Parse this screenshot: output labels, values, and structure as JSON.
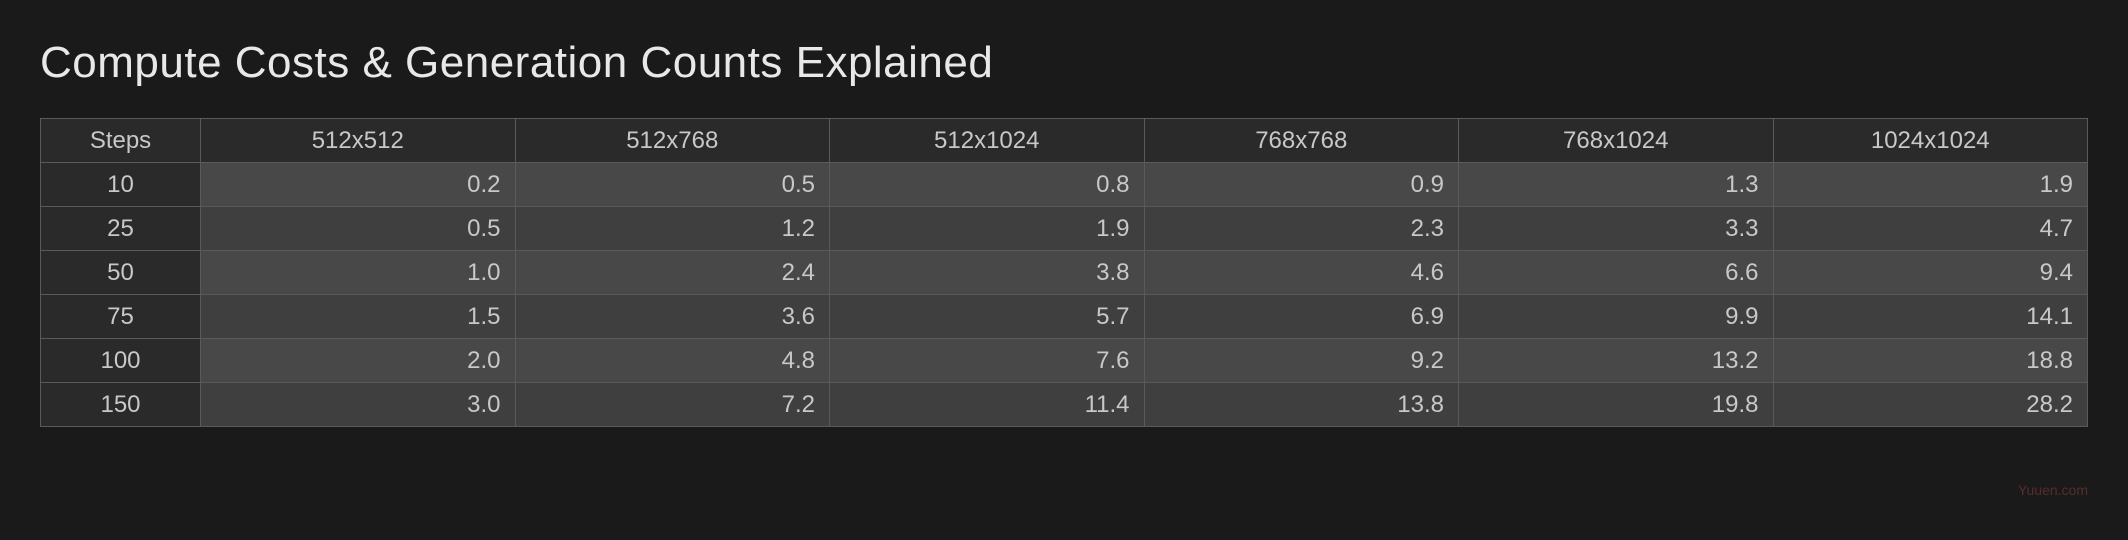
{
  "title": "Compute Costs & Generation Counts Explained",
  "chart_data": {
    "type": "table",
    "columns": [
      "Steps",
      "512x512",
      "512x768",
      "512x1024",
      "768x768",
      "768x1024",
      "1024x1024"
    ],
    "rows": [
      {
        "steps": "10",
        "values": [
          "0.2",
          "0.5",
          "0.8",
          "0.9",
          "1.3",
          "1.9"
        ]
      },
      {
        "steps": "25",
        "values": [
          "0.5",
          "1.2",
          "1.9",
          "2.3",
          "3.3",
          "4.7"
        ]
      },
      {
        "steps": "50",
        "values": [
          "1.0",
          "2.4",
          "3.8",
          "4.6",
          "6.6",
          "9.4"
        ]
      },
      {
        "steps": "75",
        "values": [
          "1.5",
          "3.6",
          "5.7",
          "6.9",
          "9.9",
          "14.1"
        ]
      },
      {
        "steps": "100",
        "values": [
          "2.0",
          "4.8",
          "7.6",
          "9.2",
          "13.2",
          "18.8"
        ]
      },
      {
        "steps": "150",
        "values": [
          "3.0",
          "7.2",
          "11.4",
          "13.8",
          "19.8",
          "28.2"
        ]
      }
    ]
  },
  "watermark": "Yuuen.com"
}
